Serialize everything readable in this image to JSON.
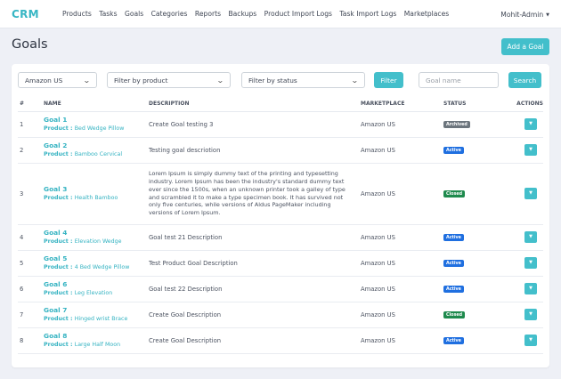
{
  "brand": "CRM",
  "nav": [
    "Products",
    "Tasks",
    "Goals",
    "Categories",
    "Reports",
    "Backups",
    "Product Import Logs",
    "Task Import Logs",
    "Marketplaces"
  ],
  "user": "Mohit-Admin",
  "page_title": "Goals",
  "add_button": "Add a Goal",
  "filters": {
    "marketplace": "Amazon US",
    "product": "Filter by product",
    "status": "Filter by status",
    "filter_button": "Filter",
    "goal_name_placeholder": "Goal name",
    "search_button": "Search"
  },
  "columns": [
    "#",
    "NAME",
    "DESCRIPTION",
    "MARKETPLACE",
    "STATUS",
    "ACTIONS"
  ],
  "product_label": "Product : ",
  "status_colors": {
    "Archived": "#6c757d",
    "Active": "#1f6fe0",
    "Closed": "#1e8a4d"
  },
  "rows": [
    {
      "num": "1",
      "name": "Goal 1",
      "product": "Bed Wedge Pillow",
      "description": "Create Goal testing 3",
      "marketplace": "Amazon US",
      "status": "Archived"
    },
    {
      "num": "2",
      "name": "Goal 2",
      "product": "Bamboo Cervical",
      "description": "Testing goal descriotion",
      "marketplace": "Amazon US",
      "status": "Active"
    },
    {
      "num": "3",
      "name": "Goal 3",
      "product": "Health Bamboo",
      "description": "Lorem Ipsum is simply dummy text of the printing and typesetting industry. Lorem Ipsum has been the industry's standard dummy text ever since the 1500s, when an unknown printer took a galley of type and scrambled it to make a type specimen book. It has survived not only five centuries, while versions of Aldus PageMaker including versions of Lorem Ipsum.",
      "marketplace": "Amazon US",
      "status": "Closed"
    },
    {
      "num": "4",
      "name": "Goal 4",
      "product": "Elevation Wedge",
      "description": "Goal test 21 Description",
      "marketplace": "Amazon US",
      "status": "Active"
    },
    {
      "num": "5",
      "name": "Goal 5",
      "product": "4 Bed Wedge Pillow",
      "description": "Test Product Goal Description",
      "marketplace": "Amazon US",
      "status": "Active"
    },
    {
      "num": "6",
      "name": "Goal 6",
      "product": "Leg Elevation",
      "description": "Goal test 22 Description",
      "marketplace": "Amazon US",
      "status": "Active"
    },
    {
      "num": "7",
      "name": "Goal 7",
      "product": "Hinged wrist Brace",
      "description": "Create Goal Description",
      "marketplace": "Amazon US",
      "status": "Closed"
    },
    {
      "num": "8",
      "name": "Goal 8",
      "product": "Large Half Moon",
      "description": "Create Goal Description",
      "marketplace": "Amazon US",
      "status": "Active"
    }
  ]
}
